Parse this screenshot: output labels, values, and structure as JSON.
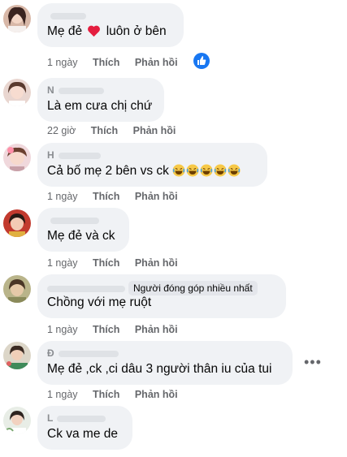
{
  "comments": [
    {
      "author": "",
      "text_before": "Mẹ đẻ",
      "text_after": "luôn ở bên",
      "time": "1 ngày",
      "like": "Thích",
      "reply": "Phản hồi"
    },
    {
      "author": "N",
      "text": "Là em cưa chị chứ",
      "time": "22 giờ",
      "like": "Thích",
      "reply": "Phản hồi"
    },
    {
      "author": "H",
      "text": "Cả bố mẹ 2 bên vs ck",
      "time": "1 ngày",
      "like": "Thích",
      "reply": "Phản hồi"
    },
    {
      "author": "",
      "text": "Mẹ đẻ và ck",
      "time": "1 ngày",
      "like": "Thích",
      "reply": "Phản hồi"
    },
    {
      "author": "",
      "badge": "Người đóng góp nhiều nhất",
      "text": "Chồng với mẹ ruột",
      "time": "1 ngày",
      "like": "Thích",
      "reply": "Phản hồi"
    },
    {
      "author": "Đ",
      "text": "Mẹ đẻ ,ck ,ci dâu 3 người thân iu của tui",
      "time": "1 ngày",
      "like": "Thích",
      "reply": "Phản hồi"
    },
    {
      "author": "L",
      "text": "Ck va me de",
      "time": "",
      "like": "",
      "reply": ""
    }
  ],
  "icons": {
    "heart": "heart-icon",
    "laugh": "laughing-emoji-icon",
    "like_reaction": "like-reaction-icon",
    "more": "more-options-icon"
  },
  "colors": {
    "bubble": "#f0f2f5",
    "meta_text": "#65676b",
    "like_blue": "#1877f2",
    "heart_red": "#e41e3f"
  }
}
